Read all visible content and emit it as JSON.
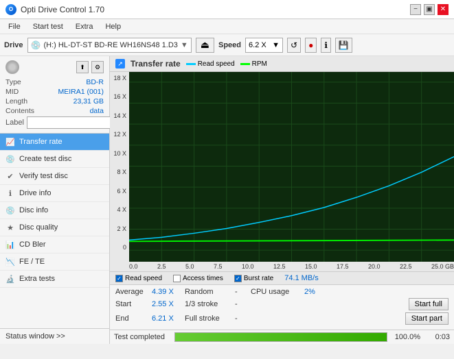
{
  "titleBar": {
    "title": "Opti Drive Control 1.70",
    "controls": [
      "minimize",
      "maximize",
      "close"
    ]
  },
  "menuBar": {
    "items": [
      "File",
      "Start test",
      "Extra",
      "Help"
    ]
  },
  "driveBar": {
    "label": "Drive",
    "driveText": "(H:)  HL-DT-ST BD-RE  WH16NS48 1.D3",
    "speedLabel": "Speed",
    "speedValue": "6.2 X"
  },
  "disc": {
    "type": "BD-R",
    "mid": "MEIRA1 (001)",
    "length": "23,31 GB",
    "contents": "data",
    "label": ""
  },
  "navItems": [
    {
      "id": "transfer-rate",
      "label": "Transfer rate",
      "active": true
    },
    {
      "id": "create-test-disc",
      "label": "Create test disc",
      "active": false
    },
    {
      "id": "verify-test-disc",
      "label": "Verify test disc",
      "active": false
    },
    {
      "id": "drive-info",
      "label": "Drive info",
      "active": false
    },
    {
      "id": "disc-info",
      "label": "Disc info",
      "active": false
    },
    {
      "id": "disc-quality",
      "label": "Disc quality",
      "active": false
    },
    {
      "id": "cd-bler",
      "label": "CD Bler",
      "active": false
    },
    {
      "id": "fe-te",
      "label": "FE / TE",
      "active": false
    },
    {
      "id": "extra-tests",
      "label": "Extra tests",
      "active": false
    }
  ],
  "statusWindow": "Status window >>",
  "chart": {
    "title": "Transfer rate",
    "legends": [
      {
        "label": "Read speed",
        "color": "#00ccff"
      },
      {
        "label": "RPM",
        "color": "#00ff00"
      }
    ],
    "yLabels": [
      "18 X",
      "16 X",
      "14 X",
      "12 X",
      "10 X",
      "8 X",
      "6 X",
      "4 X",
      "2 X",
      "0"
    ],
    "xLabels": [
      "0.0",
      "2.5",
      "5.0",
      "7.5",
      "10.0",
      "12.5",
      "15.0",
      "17.5",
      "20.0",
      "22.5",
      "25.0 GB"
    ]
  },
  "legendRow": [
    {
      "label": "Read speed",
      "checked": true
    },
    {
      "label": "Access times",
      "checked": false
    },
    {
      "label": "Burst rate",
      "checked": true,
      "value": "74.1 MB/s"
    }
  ],
  "stats": {
    "average": {
      "label": "Average",
      "value": "4.39 X"
    },
    "start": {
      "label": "Start",
      "value": "2.55 X"
    },
    "end": {
      "label": "End",
      "value": "6.21 X"
    },
    "random": {
      "label": "Random",
      "value": "-"
    },
    "stroke13": {
      "label": "1/3 stroke",
      "value": "-"
    },
    "fullStroke": {
      "label": "Full stroke",
      "value": "-"
    },
    "cpuUsage": {
      "label": "CPU usage",
      "value": "2%"
    },
    "startFull": "Start full",
    "startPart": "Start part"
  },
  "progress": {
    "label": "Test completed",
    "percent": 100,
    "percentText": "100.0%",
    "time": "0:03"
  }
}
